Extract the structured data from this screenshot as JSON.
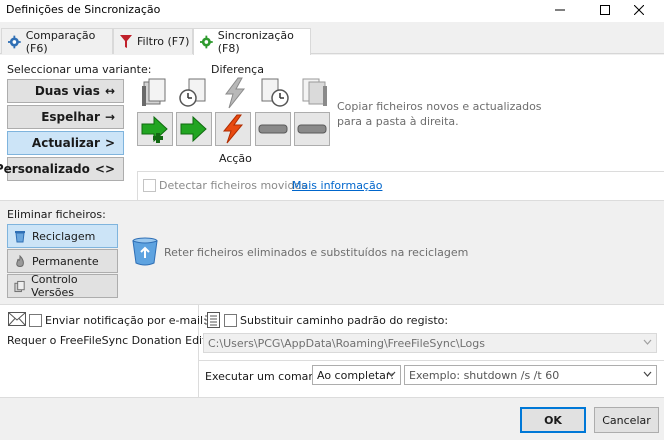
{
  "window": {
    "title": "Definições de Sincronização"
  },
  "tabs": [
    {
      "label": "Comparação (F6)"
    },
    {
      "label": "Filtro (F7)"
    },
    {
      "label": "Sincronização (F8)"
    }
  ],
  "variant": {
    "heading": "Seleccionar uma variante:",
    "buttons": [
      {
        "label": "Duas vias",
        "glyph": "↔"
      },
      {
        "label": "Espelhar",
        "glyph": "→"
      },
      {
        "label": "Actualizar",
        "glyph": ">"
      },
      {
        "label": "Personalizado",
        "glyph": "<>"
      }
    ],
    "selected": "Actualizar"
  },
  "difference": {
    "heading": "Diferença",
    "action_heading": "Acção",
    "description": "Copiar ficheiros novos e actualizados para a pasta à direita.",
    "icons": [
      "left-only-file-icon",
      "left-newer-file-icon",
      "different-file-icon",
      "right-newer-file-icon",
      "right-only-file-icon"
    ],
    "actions": [
      "create-right-icon",
      "update-right-icon",
      "conflict-icon",
      "no-action-icon",
      "no-action-icon"
    ]
  },
  "detect_moved": {
    "label": "Detectar ficheiros movidos",
    "link": "Mais informação",
    "checked": false
  },
  "delete": {
    "heading": "Eliminar ficheiros:",
    "options": [
      {
        "label": "Reciclagem"
      },
      {
        "label": "Permanente"
      },
      {
        "label": "Controlo Versões"
      }
    ],
    "selected": "Reciclagem",
    "description": "Reter ficheiros eliminados e substituídos na reciclagem"
  },
  "notify": {
    "label": "Enviar notificação por e-mail:",
    "note": "Requer o FreeFileSync Donation Edition",
    "checked": false
  },
  "log": {
    "label": "Substituir caminho padrão do registo:",
    "path": "C:\\Users\\PCG\\AppData\\Roaming\\FreeFileSync\\Logs",
    "checked": false
  },
  "command": {
    "label": "Executar um comando:",
    "when": "Ao completar:",
    "placeholder": "Exemplo: shutdown /s /t 60"
  },
  "footer": {
    "ok": "OK",
    "cancel": "Cancelar"
  },
  "colors": {
    "accent": "#0078d7",
    "selected": "#cce4f7",
    "link": "#0066cc"
  }
}
